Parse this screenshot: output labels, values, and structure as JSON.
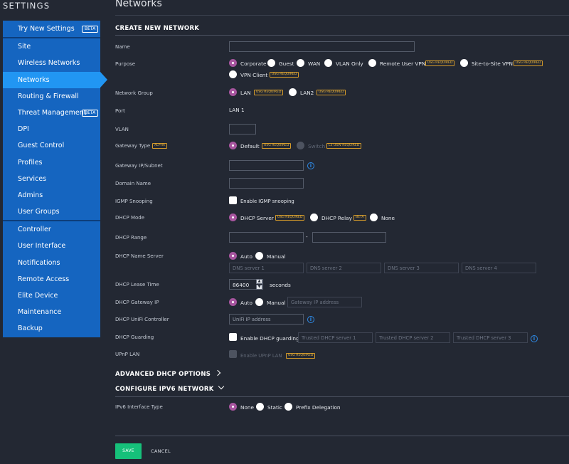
{
  "sidebar_title": "SETTINGS",
  "header_title": "Networks",
  "sidebar": {
    "groups": [
      {
        "items": [
          {
            "label": "Try New Settings",
            "badge": "BETA"
          }
        ]
      },
      {
        "items": [
          {
            "label": "Site"
          },
          {
            "label": "Wireless Networks"
          },
          {
            "label": "Networks",
            "active": true
          },
          {
            "label": "Routing & Firewall"
          },
          {
            "label": "Threat Management",
            "badge": "BETA"
          },
          {
            "label": "DPI"
          },
          {
            "label": "Guest Control"
          },
          {
            "label": "Profiles"
          },
          {
            "label": "Services"
          },
          {
            "label": "Admins"
          },
          {
            "label": "User Groups"
          }
        ]
      },
      {
        "items": [
          {
            "label": "Controller"
          },
          {
            "label": "User Interface"
          },
          {
            "label": "Notifications"
          },
          {
            "label": "Remote Access"
          },
          {
            "label": "Elite Device"
          },
          {
            "label": "Maintenance"
          },
          {
            "label": "Backup"
          }
        ]
      }
    ]
  },
  "form": {
    "section_title": "CREATE NEW NETWORK",
    "name": {
      "label": "Name",
      "value": ""
    },
    "purpose": {
      "label": "Purpose",
      "options": [
        "Corporate",
        "Guest",
        "WAN",
        "VLAN Only",
        "Remote User VPN",
        "Site-to-Site VPN",
        "VPN Client"
      ],
      "selected": "Corporate",
      "usg_tag": "USG REQUIRED"
    },
    "network_group": {
      "label": "Network Group",
      "options": [
        "LAN",
        "LAN2"
      ],
      "selected": "LAN",
      "usg_tag": "USG REQUIRED"
    },
    "port": {
      "label": "Port",
      "value": "LAN 1"
    },
    "vlan": {
      "label": "VLAN",
      "value": ""
    },
    "gateway_type": {
      "label": "Gateway Type",
      "alpha_tag": "ALPHA",
      "options": [
        "Default",
        "Switch"
      ],
      "selected": "Default",
      "default_tag": "USG REQUIRED",
      "switch_tag": "L3 USW REQUIRED"
    },
    "gateway_ip": {
      "label": "Gateway IP/Subnet",
      "value": ""
    },
    "domain_name": {
      "label": "Domain Name",
      "value": ""
    },
    "igmp": {
      "label": "IGMP Snooping",
      "checkbox_label": "Enable IGMP snooping",
      "checked": false
    },
    "dhcp_mode": {
      "label": "DHCP Mode",
      "options": [
        "DHCP Server",
        "DHCP Relay",
        "None"
      ],
      "selected": "DHCP Server",
      "server_tag": "USG REQUIRED",
      "relay_tag": "BETA"
    },
    "dhcp_range": {
      "label": "DHCP Range",
      "start": "",
      "separator": "-",
      "stop": ""
    },
    "dhcp_name_server": {
      "label": "DHCP Name Server",
      "options": [
        "Auto",
        "Manual"
      ],
      "selected": "Auto",
      "placeholders": [
        "DNS server 1",
        "DNS server 2",
        "DNS server 3",
        "DNS server 4"
      ]
    },
    "dhcp_lease_time": {
      "label": "DHCP Lease Time",
      "value": "86400",
      "unit": "seconds"
    },
    "dhcp_gateway_ip": {
      "label": "DHCP Gateway IP",
      "options": [
        "Auto",
        "Manual"
      ],
      "selected": "Auto",
      "placeholder": "Gateway IP address"
    },
    "dhcp_unifi_controller": {
      "label": "DHCP UniFi Controller",
      "placeholder": "UniFi IP address"
    },
    "dhcp_guarding": {
      "label": "DHCP Guarding",
      "checkbox_label": "Enable DHCP guarding",
      "checked": false,
      "placeholders": [
        "Trusted DHCP server 1",
        "Trusted DHCP server 2",
        "Trusted DHCP server 3"
      ]
    },
    "upnp_lan": {
      "label": "UPnP LAN",
      "checkbox_label": "Enable UPnP LAN",
      "usg_tag": "USG REQUIRED"
    },
    "advanced_dhcp": {
      "label": "ADVANCED DHCP OPTIONS"
    },
    "ipv6": {
      "label": "CONFIGURE IPV6 NETWORK",
      "interface_type_label": "IPv6 Interface Type",
      "options": [
        "None",
        "Static",
        "Prefix Delegation"
      ],
      "selected": "None"
    }
  },
  "actions": {
    "save": "SAVE",
    "cancel": "CANCEL"
  },
  "colors": {
    "sidebar": "#1565c0",
    "active": "#2196f3",
    "radio_selected": "#a7559f",
    "save": "#16c07a",
    "tag": "#d59b2a",
    "info": "#2e8ae6"
  }
}
